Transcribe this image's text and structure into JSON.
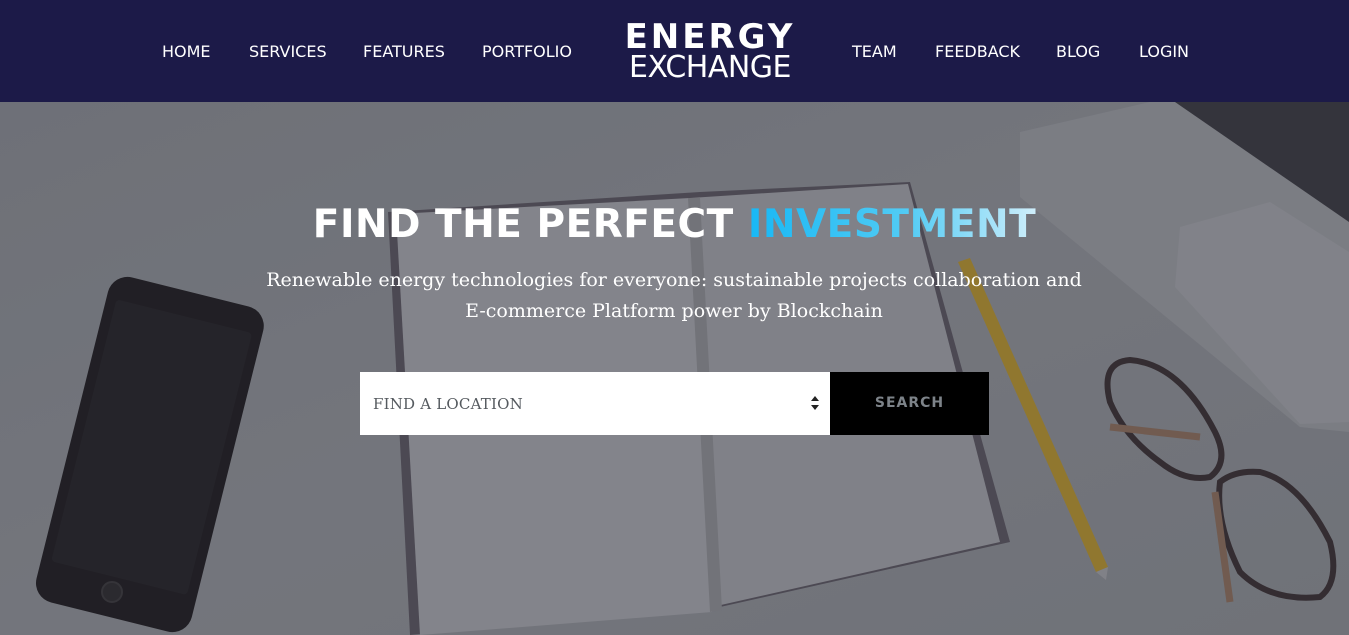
{
  "nav": {
    "left_items": [
      "HOME",
      "SERVICES",
      "FEATURES",
      "PORTFOLIO"
    ],
    "right_items": [
      "TEAM",
      "FEEDBACK",
      "BLOG",
      "LOGIN"
    ],
    "logo_line1": "ENERGY",
    "logo_line2": "EXCHANGE"
  },
  "hero": {
    "title_main": "FIND THE PERFECT ",
    "title_accent": "INVESTMENT",
    "subtitle": "Renewable energy technologies for everyone: sustainable projects collaboration and E-commerce Platform power by Blockchain"
  },
  "search": {
    "location_placeholder": "FIND A LOCATION",
    "button_label": "SEARCH"
  },
  "colors": {
    "navbar_bg": "#1c1a48",
    "accent": "#18b8f5",
    "button_bg": "#000000"
  }
}
